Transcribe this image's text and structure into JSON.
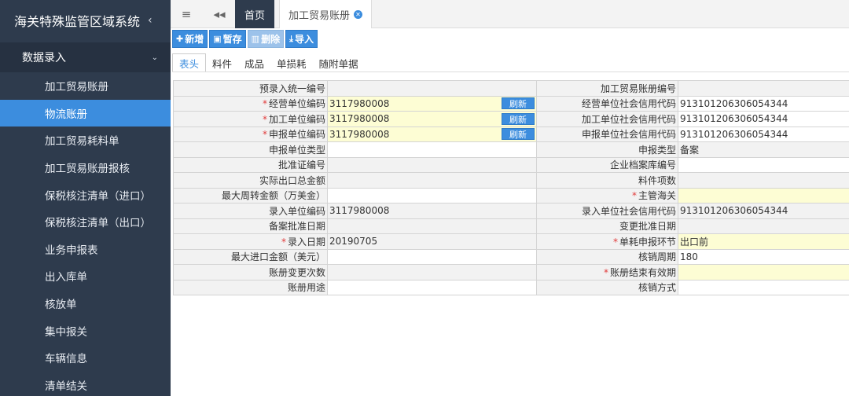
{
  "sidebar": {
    "title": "海关特殊监管区域系统",
    "section": "数据录入",
    "items": [
      {
        "label": "加工贸易账册",
        "active": false
      },
      {
        "label": "物流账册",
        "active": true
      },
      {
        "label": "加工贸易耗料单",
        "active": false
      },
      {
        "label": "加工贸易账册报核",
        "active": false
      },
      {
        "label": "保税核注清单（进口）",
        "active": false
      },
      {
        "label": "保税核注清单（出口）",
        "active": false
      },
      {
        "label": "业务申报表",
        "active": false
      },
      {
        "label": "出入库单",
        "active": false
      },
      {
        "label": "核放单",
        "active": false
      },
      {
        "label": "集中报关",
        "active": false
      },
      {
        "label": "车辆信息",
        "active": false
      },
      {
        "label": "清单结关",
        "active": false
      }
    ]
  },
  "topbar": {
    "menu_icon": "hamburger-icon",
    "back_icon": "double-chevron-left-icon",
    "home_tab": "首页",
    "ledger_tab": "加工贸易账册"
  },
  "toolbar": {
    "add": "新增",
    "save": "暂存",
    "delete": "删除",
    "import": "导入"
  },
  "subtabs": [
    "表头",
    "料件",
    "成品",
    "单损耗",
    "随附单据"
  ],
  "form": {
    "refresh_label": "刷新",
    "rows": [
      {
        "l1": "预录入统一编号",
        "v1": "",
        "l2": "加工贸易账册编号",
        "v2": ""
      },
      {
        "l1": "经营单位编码",
        "v1": "3117980008",
        "l2": "经营单位社会信用代码",
        "v2": "913101206306054344"
      },
      {
        "l1": "加工单位编码",
        "v1": "3117980008",
        "l2": "加工单位社会信用代码",
        "v2": "913101206306054344"
      },
      {
        "l1": "申报单位编码",
        "v1": "3117980008",
        "l2": "申报单位社会信用代码",
        "v2": "913101206306054344"
      },
      {
        "l1": "申报单位类型",
        "v1": "",
        "l2": "申报类型",
        "v2": "备案"
      },
      {
        "l1": "批准证编号",
        "v1": "",
        "l2": "企业档案库编号",
        "v2": ""
      },
      {
        "l1": "实际出口总金额",
        "v1": "",
        "l2": "料件项数",
        "v2": ""
      },
      {
        "l1": "最大周转金额（万美金）",
        "v1": "",
        "l2": "主管海关",
        "v2": ""
      },
      {
        "l1": "录入单位编码",
        "v1": "3117980008",
        "l2": "录入单位社会信用代码",
        "v2": "913101206306054344"
      },
      {
        "l1": "备案批准日期",
        "v1": "",
        "l2": "变更批准日期",
        "v2": ""
      },
      {
        "l1": "录入日期",
        "v1": "20190705",
        "l2": "单耗申报环节",
        "v2": "出口前"
      },
      {
        "l1": "最大进口金额（美元）",
        "v1": "",
        "l2": "核销周期",
        "v2": "180"
      },
      {
        "l1": "账册变更次数",
        "v1": "",
        "l2": "账册结束有效期",
        "v2": ""
      },
      {
        "l1": "账册用途",
        "v1": "",
        "l2": "核销方式",
        "v2": ""
      }
    ]
  },
  "colors": {
    "sidebar_bg": "#2e3b4d",
    "accent": "#3c8dde",
    "required_bg": "#fdfdd4",
    "required_star": "#e23c3c"
  }
}
